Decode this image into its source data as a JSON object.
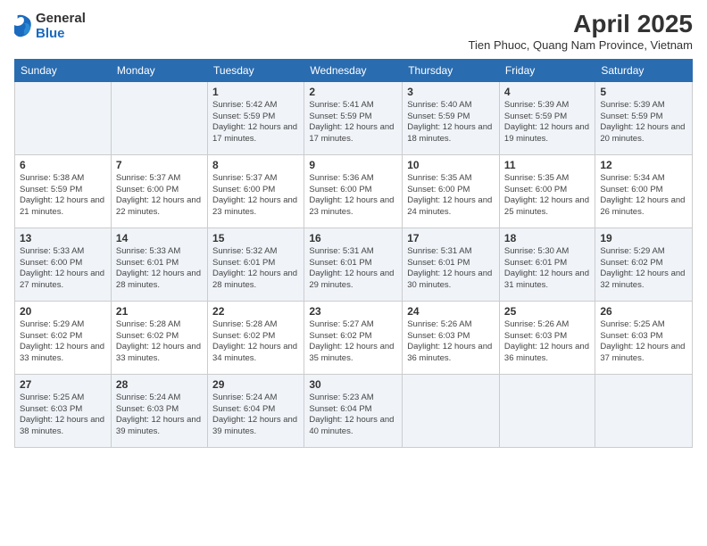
{
  "header": {
    "logo_general": "General",
    "logo_blue": "Blue",
    "month_title": "April 2025",
    "location": "Tien Phuoc, Quang Nam Province, Vietnam"
  },
  "days_of_week": [
    "Sunday",
    "Monday",
    "Tuesday",
    "Wednesday",
    "Thursday",
    "Friday",
    "Saturday"
  ],
  "weeks": [
    [
      {
        "day": "",
        "info": ""
      },
      {
        "day": "",
        "info": ""
      },
      {
        "day": "1",
        "info": "Sunrise: 5:42 AM\nSunset: 5:59 PM\nDaylight: 12 hours and 17 minutes."
      },
      {
        "day": "2",
        "info": "Sunrise: 5:41 AM\nSunset: 5:59 PM\nDaylight: 12 hours and 17 minutes."
      },
      {
        "day": "3",
        "info": "Sunrise: 5:40 AM\nSunset: 5:59 PM\nDaylight: 12 hours and 18 minutes."
      },
      {
        "day": "4",
        "info": "Sunrise: 5:39 AM\nSunset: 5:59 PM\nDaylight: 12 hours and 19 minutes."
      },
      {
        "day": "5",
        "info": "Sunrise: 5:39 AM\nSunset: 5:59 PM\nDaylight: 12 hours and 20 minutes."
      }
    ],
    [
      {
        "day": "6",
        "info": "Sunrise: 5:38 AM\nSunset: 5:59 PM\nDaylight: 12 hours and 21 minutes."
      },
      {
        "day": "7",
        "info": "Sunrise: 5:37 AM\nSunset: 6:00 PM\nDaylight: 12 hours and 22 minutes."
      },
      {
        "day": "8",
        "info": "Sunrise: 5:37 AM\nSunset: 6:00 PM\nDaylight: 12 hours and 23 minutes."
      },
      {
        "day": "9",
        "info": "Sunrise: 5:36 AM\nSunset: 6:00 PM\nDaylight: 12 hours and 23 minutes."
      },
      {
        "day": "10",
        "info": "Sunrise: 5:35 AM\nSunset: 6:00 PM\nDaylight: 12 hours and 24 minutes."
      },
      {
        "day": "11",
        "info": "Sunrise: 5:35 AM\nSunset: 6:00 PM\nDaylight: 12 hours and 25 minutes."
      },
      {
        "day": "12",
        "info": "Sunrise: 5:34 AM\nSunset: 6:00 PM\nDaylight: 12 hours and 26 minutes."
      }
    ],
    [
      {
        "day": "13",
        "info": "Sunrise: 5:33 AM\nSunset: 6:00 PM\nDaylight: 12 hours and 27 minutes."
      },
      {
        "day": "14",
        "info": "Sunrise: 5:33 AM\nSunset: 6:01 PM\nDaylight: 12 hours and 28 minutes."
      },
      {
        "day": "15",
        "info": "Sunrise: 5:32 AM\nSunset: 6:01 PM\nDaylight: 12 hours and 28 minutes."
      },
      {
        "day": "16",
        "info": "Sunrise: 5:31 AM\nSunset: 6:01 PM\nDaylight: 12 hours and 29 minutes."
      },
      {
        "day": "17",
        "info": "Sunrise: 5:31 AM\nSunset: 6:01 PM\nDaylight: 12 hours and 30 minutes."
      },
      {
        "day": "18",
        "info": "Sunrise: 5:30 AM\nSunset: 6:01 PM\nDaylight: 12 hours and 31 minutes."
      },
      {
        "day": "19",
        "info": "Sunrise: 5:29 AM\nSunset: 6:02 PM\nDaylight: 12 hours and 32 minutes."
      }
    ],
    [
      {
        "day": "20",
        "info": "Sunrise: 5:29 AM\nSunset: 6:02 PM\nDaylight: 12 hours and 33 minutes."
      },
      {
        "day": "21",
        "info": "Sunrise: 5:28 AM\nSunset: 6:02 PM\nDaylight: 12 hours and 33 minutes."
      },
      {
        "day": "22",
        "info": "Sunrise: 5:28 AM\nSunset: 6:02 PM\nDaylight: 12 hours and 34 minutes."
      },
      {
        "day": "23",
        "info": "Sunrise: 5:27 AM\nSunset: 6:02 PM\nDaylight: 12 hours and 35 minutes."
      },
      {
        "day": "24",
        "info": "Sunrise: 5:26 AM\nSunset: 6:03 PM\nDaylight: 12 hours and 36 minutes."
      },
      {
        "day": "25",
        "info": "Sunrise: 5:26 AM\nSunset: 6:03 PM\nDaylight: 12 hours and 36 minutes."
      },
      {
        "day": "26",
        "info": "Sunrise: 5:25 AM\nSunset: 6:03 PM\nDaylight: 12 hours and 37 minutes."
      }
    ],
    [
      {
        "day": "27",
        "info": "Sunrise: 5:25 AM\nSunset: 6:03 PM\nDaylight: 12 hours and 38 minutes."
      },
      {
        "day": "28",
        "info": "Sunrise: 5:24 AM\nSunset: 6:03 PM\nDaylight: 12 hours and 39 minutes."
      },
      {
        "day": "29",
        "info": "Sunrise: 5:24 AM\nSunset: 6:04 PM\nDaylight: 12 hours and 39 minutes."
      },
      {
        "day": "30",
        "info": "Sunrise: 5:23 AM\nSunset: 6:04 PM\nDaylight: 12 hours and 40 minutes."
      },
      {
        "day": "",
        "info": ""
      },
      {
        "day": "",
        "info": ""
      },
      {
        "day": "",
        "info": ""
      }
    ]
  ]
}
